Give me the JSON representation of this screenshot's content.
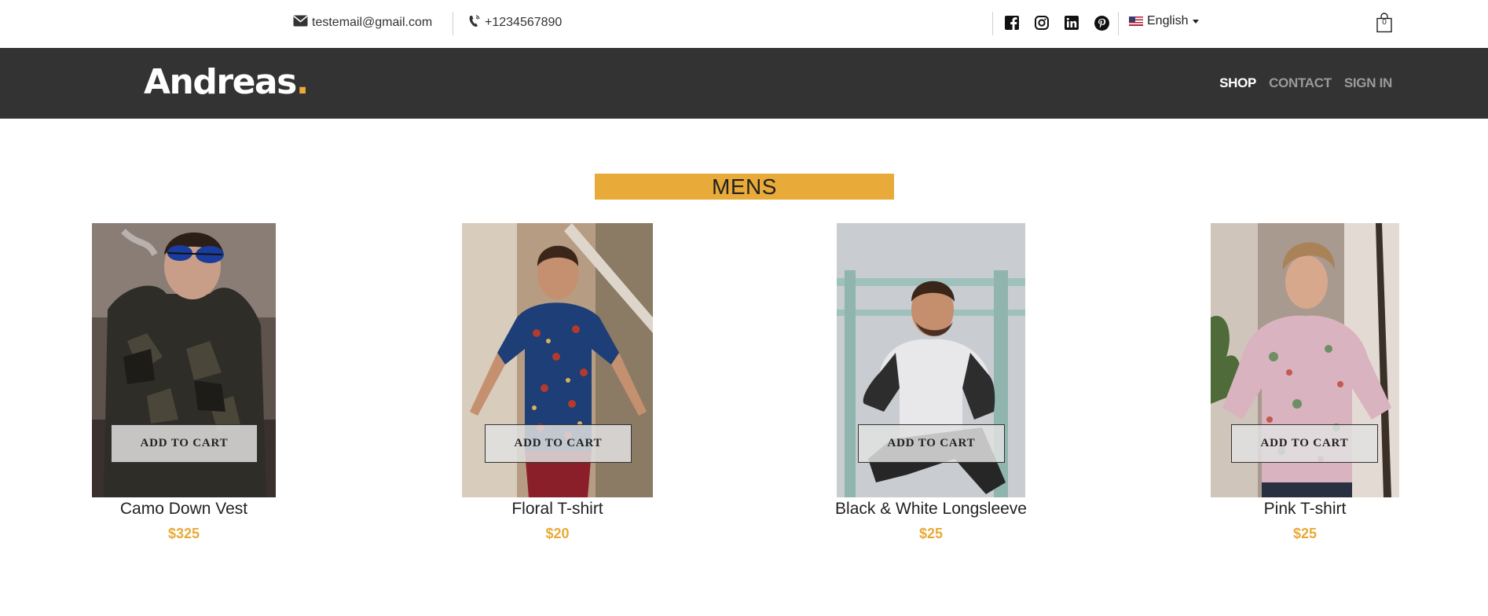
{
  "topbar": {
    "email": "testemail@gmail.com",
    "phone": "+1234567890",
    "social": [
      "facebook-icon",
      "instagram-icon",
      "linkedin-icon",
      "pinterest-icon"
    ],
    "language": "English",
    "cart_count": "0"
  },
  "navbar": {
    "logo_text": "Andreas",
    "logo_dot": ".",
    "links": [
      {
        "label": "SHOP",
        "active": true
      },
      {
        "label": "CONTACT",
        "active": false
      },
      {
        "label": "SIGN IN",
        "active": false
      }
    ]
  },
  "section": {
    "title": "MENS"
  },
  "products": [
    {
      "name": "Camo Down Vest",
      "price": "$325",
      "button": "ADD TO CART"
    },
    {
      "name": "Floral T-shirt",
      "price": "$20",
      "button": "ADD TO CART"
    },
    {
      "name": "Black & White Longsleeve",
      "price": "$25",
      "button": "ADD TO CART"
    },
    {
      "name": "Pink T-shirt",
      "price": "$25",
      "button": "ADD TO CART"
    }
  ],
  "colors": {
    "accent": "#e8aa38",
    "navbar_bg": "#333333",
    "nav_active": "#ffffff",
    "nav_inactive": "#9a9a9a"
  }
}
